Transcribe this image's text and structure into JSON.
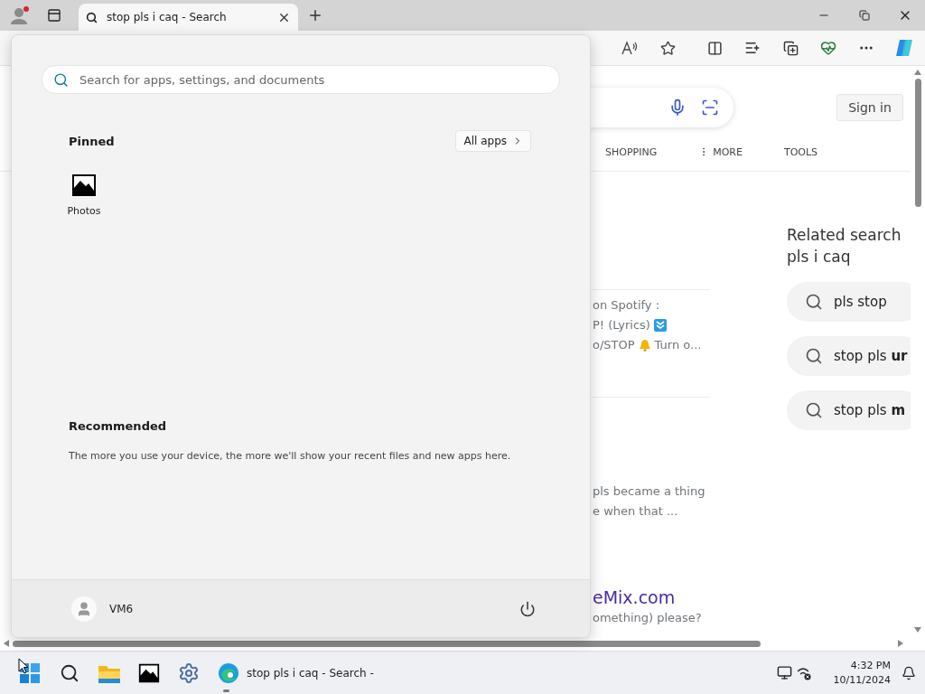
{
  "browser": {
    "tabs": [
      {
        "title": "stop pls i caq - Search",
        "selected": true
      }
    ]
  },
  "page": {
    "sign_in": "Sign in",
    "nav": [
      {
        "label": "SHOPPING",
        "kind": "link"
      },
      {
        "label": "MORE",
        "kind": "menu"
      },
      {
        "label": "TOOLS",
        "kind": "link"
      }
    ],
    "results": [
      {
        "lines": [
          {
            "text": "on Spotify :",
            "kind": "plain"
          },
          {
            "text": "P! (Lyrics)",
            "kind": "download"
          },
          {
            "text": "o/STOP",
            "kind": "bell",
            "after": "Turn o..."
          }
        ]
      },
      {
        "lines": [
          {
            "text": "pls became a thing",
            "kind": "plain"
          },
          {
            "text": "e when that ...",
            "kind": "plain"
          }
        ]
      },
      {
        "title": "eMix.com",
        "lines": [
          {
            "text": "omething) please?",
            "kind": "plain"
          }
        ]
      }
    ],
    "related": {
      "heading": "Related search",
      "query": "pls i caq",
      "items": [
        "pls stop",
        "stop pls **ur**",
        "stop pls **m**"
      ]
    }
  },
  "start_menu": {
    "search_placeholder": "Search for apps, settings, and documents",
    "pinned_title": "Pinned",
    "all_apps": "All apps",
    "pinned": [
      {
        "name": "Photos"
      }
    ],
    "recommended_title": "Recommended",
    "recommended_text": "The more you use your device, the more we'll show your recent files and new apps here.",
    "user": "VM6"
  },
  "taskbar": {
    "apps": [
      {
        "kind": "start"
      },
      {
        "kind": "search"
      },
      {
        "kind": "explorer"
      },
      {
        "kind": "photos"
      },
      {
        "kind": "settings"
      },
      {
        "kind": "edge",
        "label": "stop pls i caq - Search -",
        "running": true
      }
    ],
    "time": "4:32 PM",
    "date": "10/11/2024"
  }
}
